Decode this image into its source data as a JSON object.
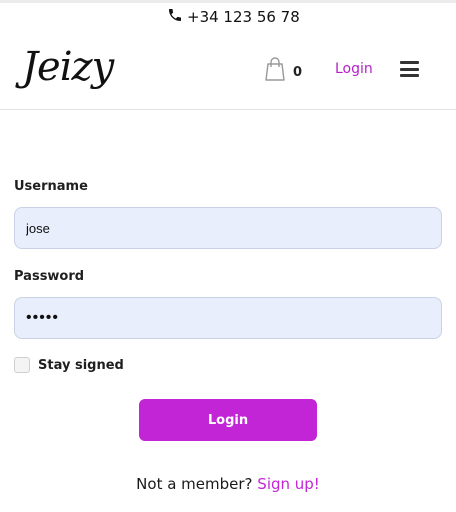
{
  "topbar": {
    "phone": "+34 123 56 78",
    "phone_icon": "phone-icon"
  },
  "header": {
    "logo": "Jeizy",
    "cart_icon": "shopping-bag-icon",
    "cart_count": "0",
    "login_link": "Login",
    "menu_icon": "hamburger-menu-icon"
  },
  "form": {
    "username_label": "Username",
    "username_value": "jose",
    "password_label": "Password",
    "password_value": "•••••",
    "stay_signed_label": "Stay signed",
    "stay_signed_checked": false,
    "submit_label": "Login"
  },
  "footer": {
    "prompt": "Not a member?",
    "signup_link": "Sign up!"
  },
  "colors": {
    "accent": "#c225d6",
    "input_bg": "#e8eefb"
  }
}
